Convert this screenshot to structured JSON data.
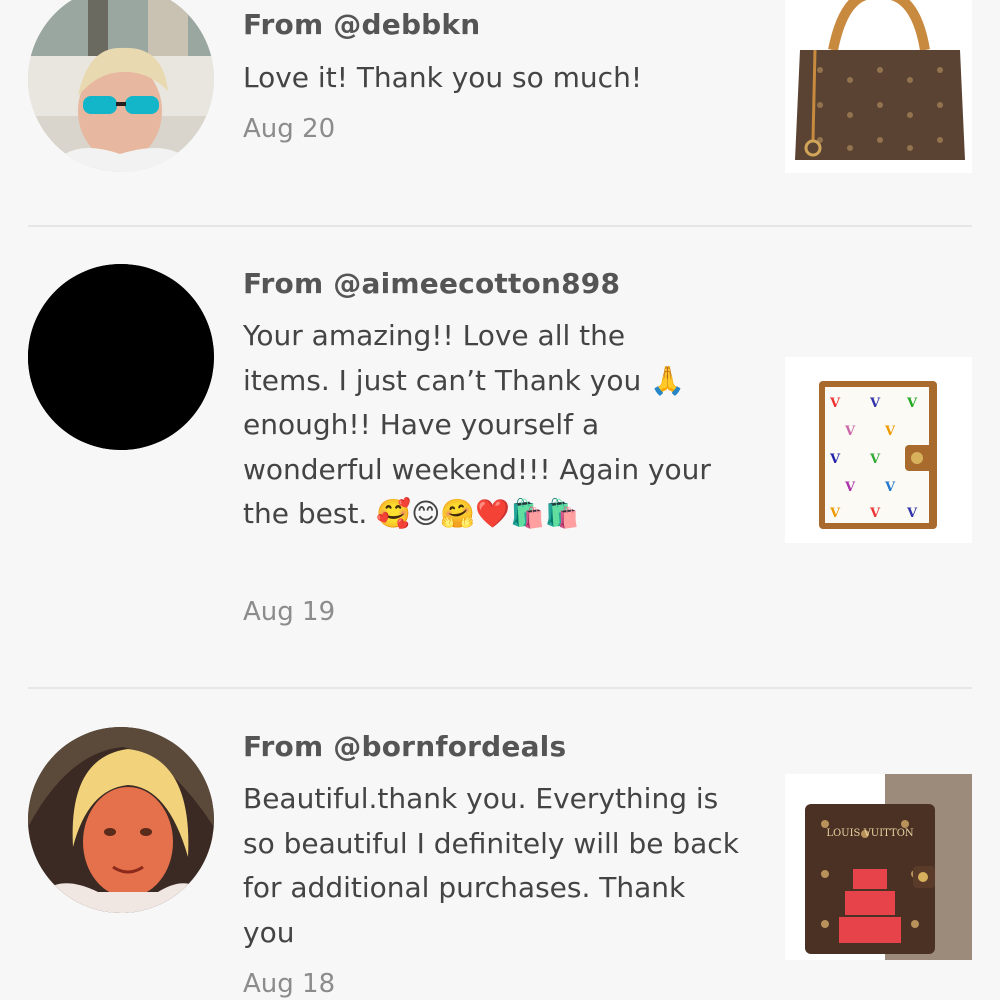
{
  "reviews": [
    {
      "from": "From @debbkn",
      "message": "Love it! Thank you so much!",
      "date": "Aug 20"
    },
    {
      "from": "From @aimeecotton898",
      "message": "Your amazing!! Love all the items. I just can’t Thank you 🙏 enough!! Have yourself a wonderful weekend!!! Again your the best. 🥰😊🤗❤️🛍️🛍️",
      "date": "Aug 19"
    },
    {
      "from": "From @bornfordeals",
      "message": "Beautiful.thank you. Everything is so beautiful I definitely will be back for additional purchases. Thank you",
      "date": "Aug 18"
    }
  ],
  "thumbs": {
    "agenda_logo_text": "LOUIS VUITTON"
  },
  "colors": {
    "background": "#f7f7f7",
    "divider": "#e6e6e6",
    "username": "#555555",
    "date": "#8c8c8c"
  }
}
